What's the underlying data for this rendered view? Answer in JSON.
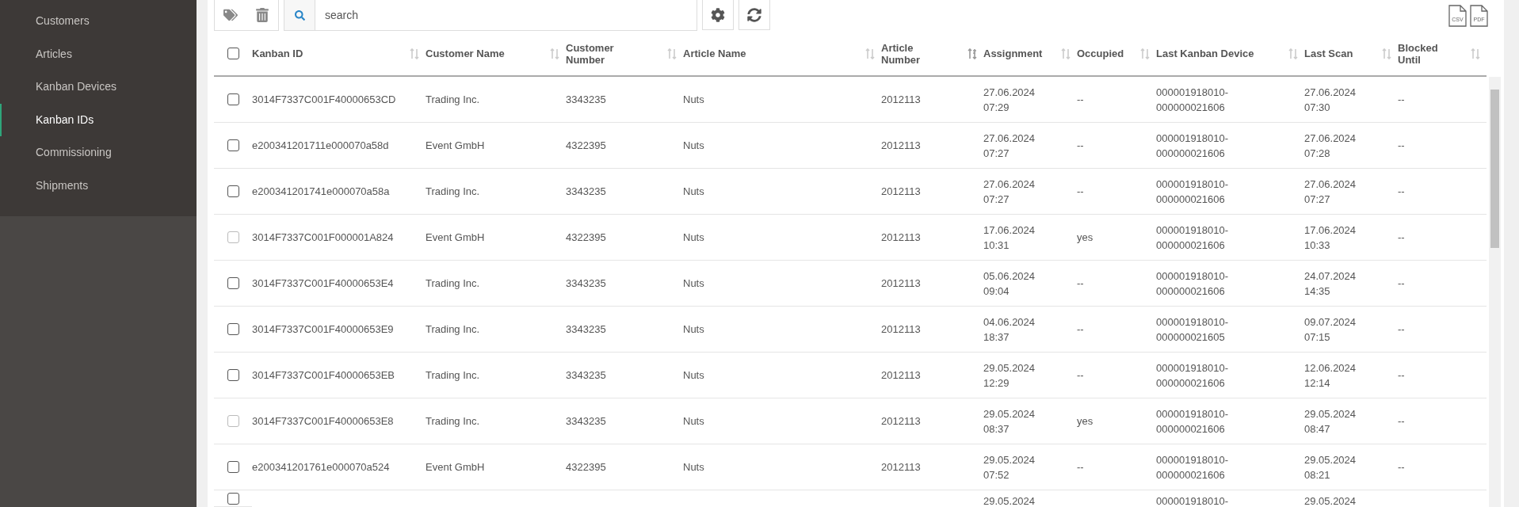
{
  "sidebar": {
    "items": [
      {
        "label": "Customers",
        "selected": false
      },
      {
        "label": "Articles",
        "selected": false
      },
      {
        "label": "Kanban Devices",
        "selected": false
      },
      {
        "label": "Kanban IDs",
        "selected": true
      },
      {
        "label": "Commissioning",
        "selected": false
      },
      {
        "label": "Shipments",
        "selected": false
      }
    ]
  },
  "toolbar": {
    "search": {
      "placeholder": "search"
    },
    "export": [
      "CSV",
      "PDF"
    ]
  },
  "table": {
    "select_all": {
      "checked": false
    },
    "columns": [
      {
        "label": "Kanban ID",
        "sorted": false
      },
      {
        "label": "Customer Name",
        "sorted": false
      },
      {
        "label": "Customer Number",
        "sorted": false
      },
      {
        "label": "Article Name",
        "sorted": false
      },
      {
        "label": "Article Number",
        "sorted": true
      },
      {
        "label": "Assignment",
        "sorted": false
      },
      {
        "label": "Occupied",
        "sorted": false
      },
      {
        "label": "Last Kanban Device",
        "sorted": false
      },
      {
        "label": "Last Scan",
        "sorted": false
      },
      {
        "label": "Blocked Until",
        "sorted": false
      }
    ],
    "rows": [
      {
        "disabled": false,
        "cells": [
          "3014F7337C001F40000653CD",
          "Trading Inc.",
          "3343235",
          "Nuts",
          "2012113",
          "27.06.2024 07:29",
          "--",
          "000001918010-000000021606",
          "27.06.2024 07:30",
          "--"
        ]
      },
      {
        "disabled": false,
        "cells": [
          "e200341201711e000070a58d",
          "Event GmbH",
          "4322395",
          "Nuts",
          "2012113",
          "27.06.2024 07:27",
          "--",
          "000001918010-000000021606",
          "27.06.2024 07:28",
          "--"
        ]
      },
      {
        "disabled": false,
        "cells": [
          "e200341201741e000070a58a",
          "Trading Inc.",
          "3343235",
          "Nuts",
          "2012113",
          "27.06.2024 07:27",
          "--",
          "000001918010-000000021606",
          "27.06.2024 07:27",
          "--"
        ]
      },
      {
        "disabled": true,
        "cells": [
          "3014F7337C001F000001A824",
          "Event GmbH",
          "4322395",
          "Nuts",
          "2012113",
          "17.06.2024 10:31",
          "yes",
          "000001918010-000000021606",
          "17.06.2024 10:33",
          "--"
        ]
      },
      {
        "disabled": false,
        "cells": [
          "3014F7337C001F40000653E4",
          "Trading Inc.",
          "3343235",
          "Nuts",
          "2012113",
          "05.06.2024 09:04",
          "--",
          "000001918010-000000021606",
          "24.07.2024 14:35",
          "--"
        ]
      },
      {
        "disabled": false,
        "cells": [
          "3014F7337C001F40000653E9",
          "Trading Inc.",
          "3343235",
          "Nuts",
          "2012113",
          "04.06.2024 18:37",
          "--",
          "000001918010-000000021605",
          "09.07.2024 07:15",
          "--"
        ]
      },
      {
        "disabled": false,
        "cells": [
          "3014F7337C001F40000653EB",
          "Trading Inc.",
          "3343235",
          "Nuts",
          "2012113",
          "29.05.2024 12:29",
          "--",
          "000001918010-000000021606",
          "12.06.2024 12:14",
          "--"
        ]
      },
      {
        "disabled": true,
        "cells": [
          "3014F7337C001F40000653E8",
          "Trading Inc.",
          "3343235",
          "Nuts",
          "2012113",
          "29.05.2024 08:37",
          "yes",
          "000001918010-000000021606",
          "29.05.2024 08:47",
          "--"
        ]
      },
      {
        "disabled": false,
        "cells": [
          "e200341201761e000070a524",
          "Event GmbH",
          "4322395",
          "Nuts",
          "2012113",
          "29.05.2024 07:52",
          "--",
          "000001918010-000000021606",
          "29.05.2024 08:21",
          "--"
        ]
      },
      {
        "disabled": false,
        "cells": [
          "",
          "",
          "",
          "",
          "",
          "29.05.2024",
          "",
          "000001918010-",
          "29.05.2024",
          ""
        ]
      }
    ]
  }
}
